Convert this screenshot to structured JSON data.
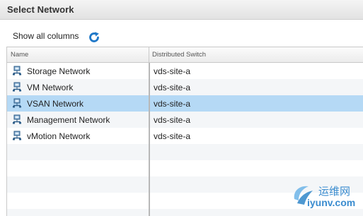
{
  "dialog": {
    "title": "Select Network"
  },
  "toolbar": {
    "show_all_label": "Show all columns",
    "refresh_icon": "refresh-icon",
    "accent_color": "#1f78c8"
  },
  "table": {
    "columns": [
      {
        "label": "Name"
      },
      {
        "label": "Distributed Switch"
      }
    ],
    "rows": [
      {
        "name": "Storage Network",
        "switch": "vds-site-a",
        "icon": "network-icon",
        "selected": false
      },
      {
        "name": "VM Network",
        "switch": "vds-site-a",
        "icon": "network-icon",
        "selected": false
      },
      {
        "name": "VSAN Network",
        "switch": "vds-site-a",
        "icon": "network-icon",
        "selected": true
      },
      {
        "name": "Management Network",
        "switch": "vds-site-a",
        "icon": "network-icon",
        "selected": false
      },
      {
        "name": "vMotion Network",
        "switch": "vds-site-a",
        "icon": "network-icon",
        "selected": false
      }
    ],
    "selected_color": "#b5d9f5"
  },
  "watermark": {
    "cn_text": "运维网",
    "en_text": "iyunv.com"
  }
}
